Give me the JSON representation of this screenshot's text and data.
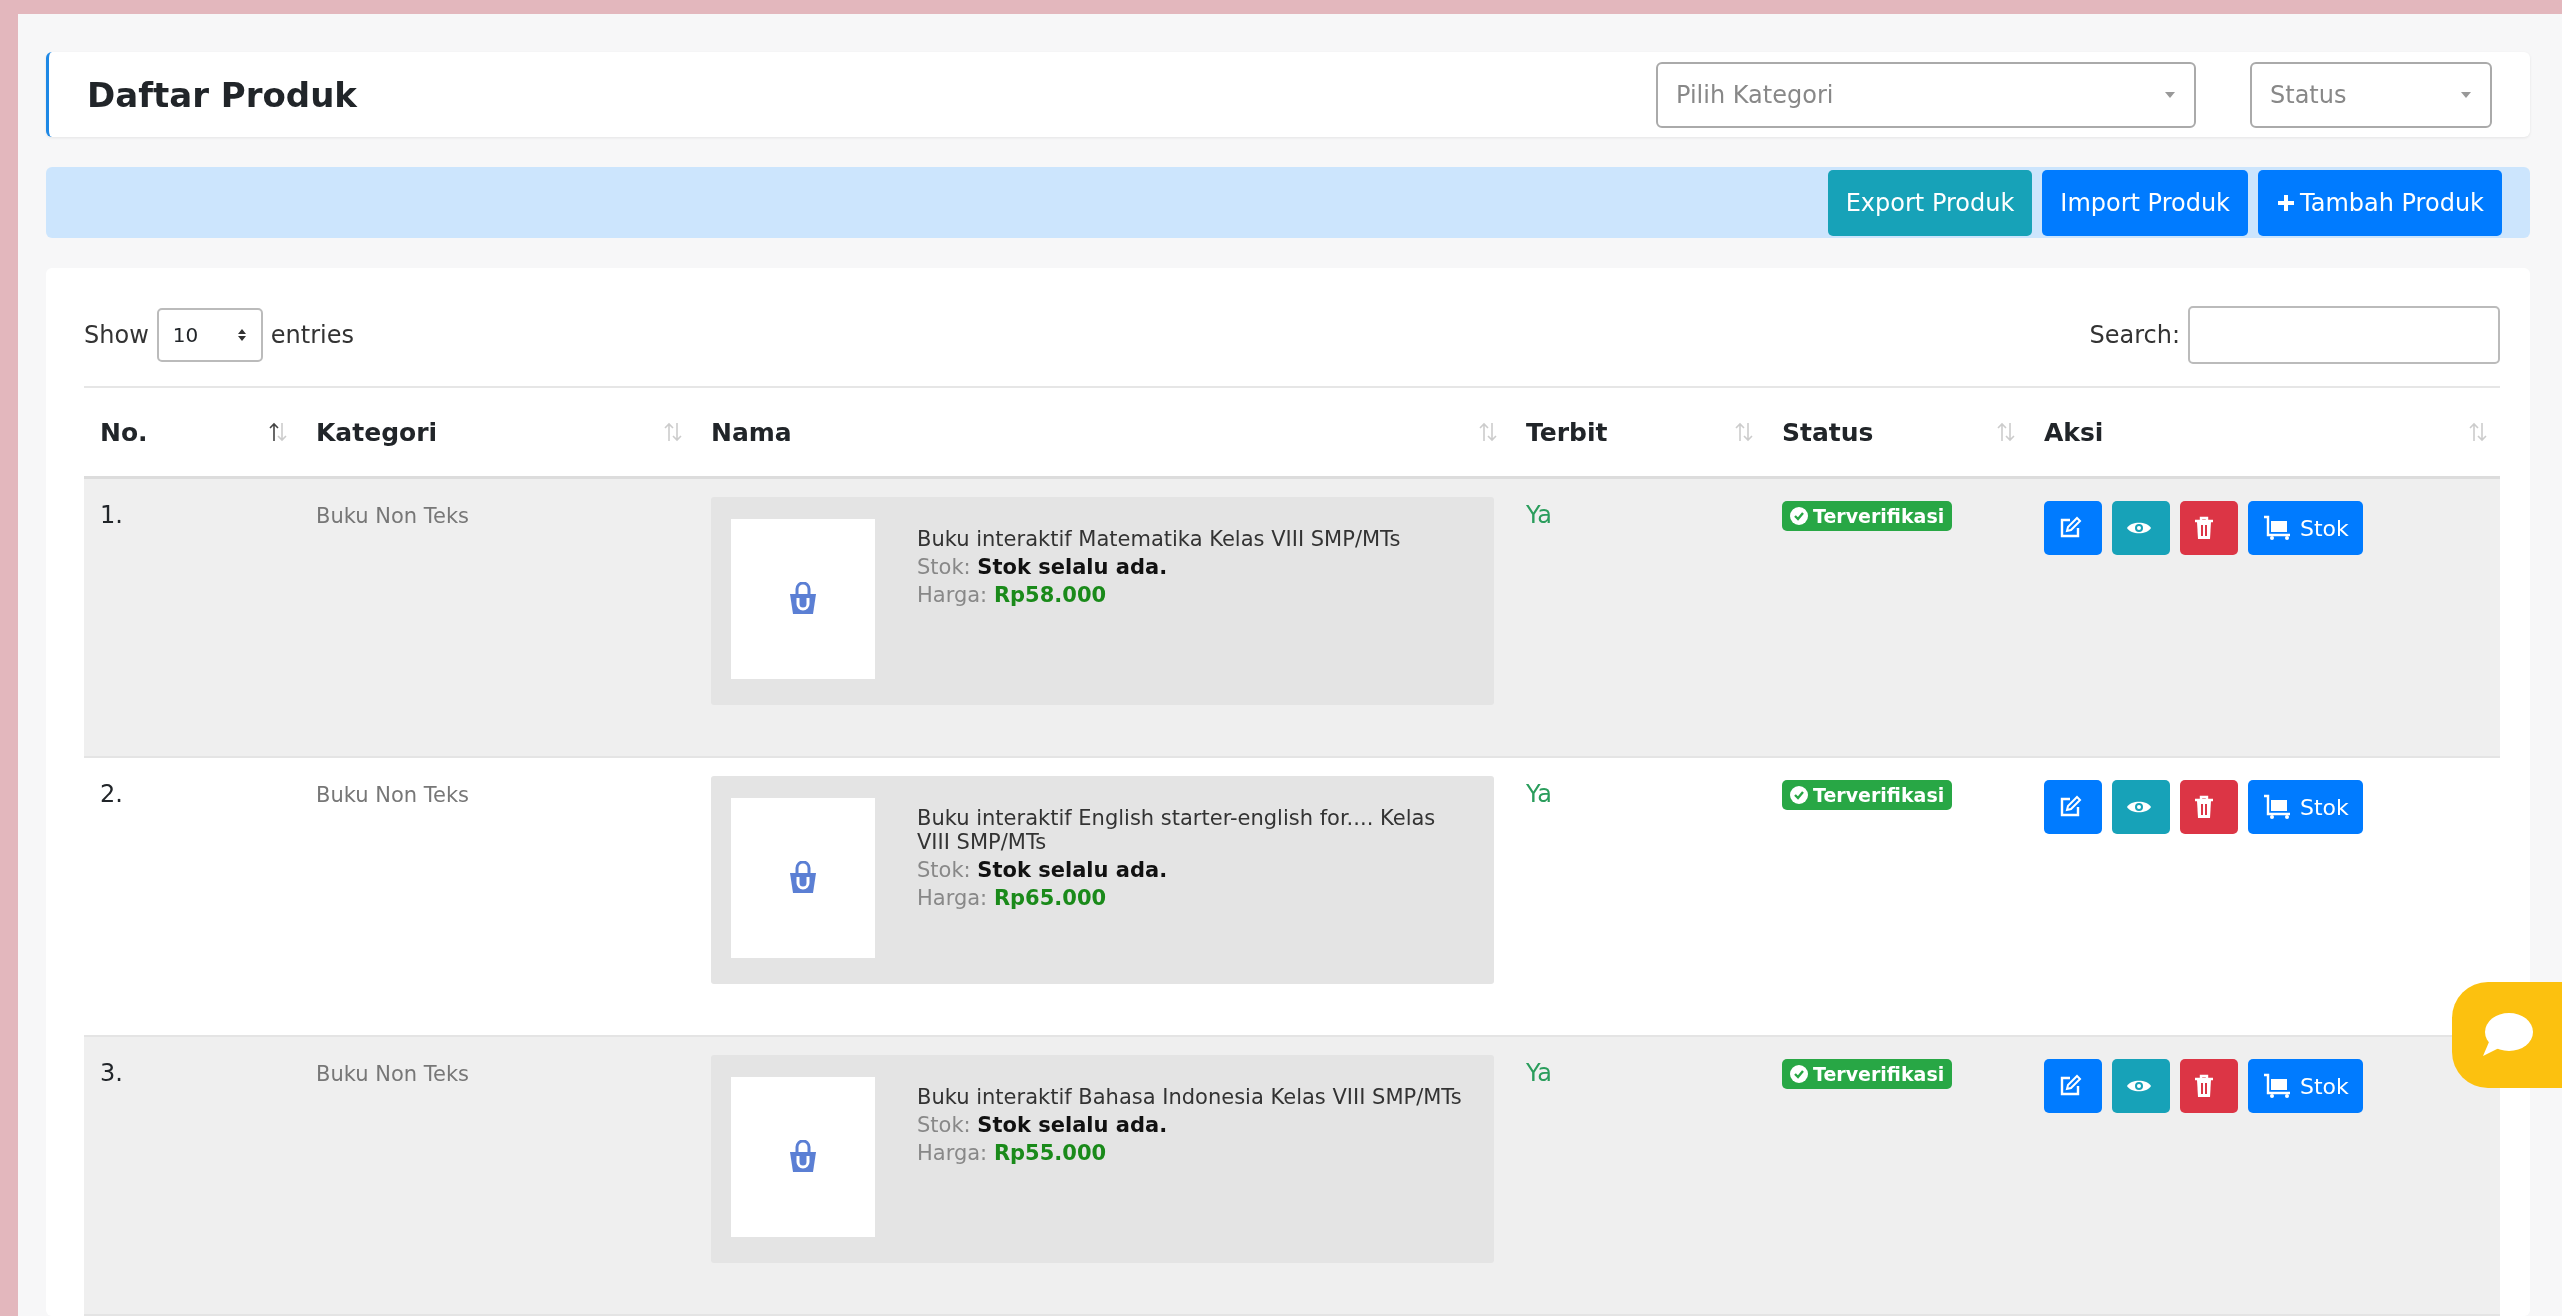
{
  "page_title": "Daftar Produk",
  "filters": [
    {
      "placeholder": "Pilih Kategori",
      "kind": "wide"
    },
    {
      "placeholder": "Status",
      "kind": "narrow"
    }
  ],
  "actions": [
    {
      "label": "Export Produk",
      "kind": "info"
    },
    {
      "label": "Import Produk",
      "kind": "primary"
    },
    {
      "label": "Tambah Produk",
      "kind": "add"
    }
  ],
  "length": {
    "before": "Show",
    "value": "10",
    "after": "entries"
  },
  "search": {
    "label": "Search:"
  },
  "table": {
    "columns": [
      {
        "label": "No.",
        "sorted": true
      },
      {
        "label": "Kategori",
        "sorted": false
      },
      {
        "label": "Nama",
        "sorted": false
      },
      {
        "label": "Terbit",
        "sorted": false
      },
      {
        "label": "Status",
        "sorted": false
      },
      {
        "label": "Aksi",
        "sorted": false
      }
    ],
    "rows": [
      {
        "no": "1.",
        "category": "Buku Non Teks",
        "name": "Buku interaktif Matematika Kelas VIII SMP/MTs",
        "stock_label": "Stok:",
        "stock": "Stok selalu ada.",
        "price_label": "Harga:",
        "price": "Rp58.000",
        "published": "Ya",
        "status": "Terverifikasi",
        "stock_button": "Stok"
      },
      {
        "no": "2.",
        "category": "Buku Non Teks",
        "name": "Buku interaktif English starter-english for.... Kelas VIII SMP/MTs",
        "stock_label": "Stok:",
        "stock": "Stok selalu ada.",
        "price_label": "Harga:",
        "price": "Rp65.000",
        "published": "Ya",
        "status": "Terverifikasi",
        "stock_button": "Stok"
      },
      {
        "no": "3.",
        "category": "Buku Non Teks",
        "name": "Buku interaktif Bahasa Indonesia Kelas VIII SMP/MTs",
        "stock_label": "Stok:",
        "stock": "Stok selalu ada.",
        "price_label": "Harga:",
        "price": "Rp55.000",
        "published": "Ya",
        "status": "Terverifikasi",
        "stock_button": "Stok"
      }
    ]
  }
}
